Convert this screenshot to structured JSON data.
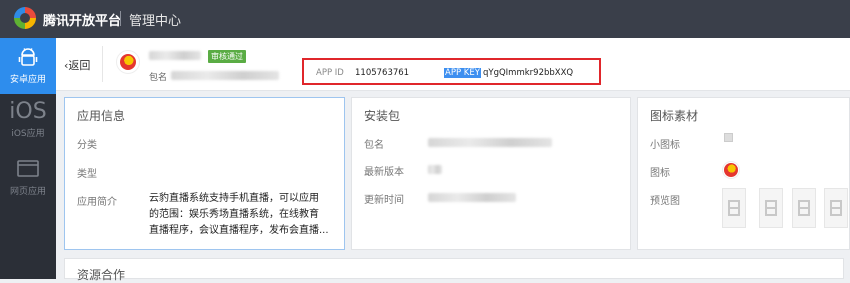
{
  "topbar": {
    "brand": "腾讯开放平台",
    "title": "管理中心",
    "logo_icon": "tencent-open-platform-logo-icon"
  },
  "sidebar": {
    "items": [
      {
        "label": "安卓应用",
        "icon": "android-icon",
        "active": true
      },
      {
        "label": "iOS应用",
        "icon": "ios-icon",
        "icon_text": "iOS",
        "active": false
      },
      {
        "label": "网页应用",
        "icon": "browser-window-icon",
        "active": false
      }
    ]
  },
  "subheader": {
    "back_label": "返回",
    "back_icon": "chevron-left-icon",
    "status_badge": "审核通过",
    "package_label": "包名",
    "app_id_label": "APP ID",
    "app_id_value": "1105763761",
    "app_key_label": "APP KEY",
    "app_key_value": "qYgQImmkr92bbXXQ",
    "highlight_color": "#e0262b"
  },
  "panels": {
    "app_info": {
      "title": "应用信息",
      "category_label": "分类",
      "type_label": "类型",
      "summary_label": "应用简介",
      "summary_lines": [
        "云豹直播系统支持手机直播，可以应用",
        "的范围：娱乐秀场直播系统，在线教育",
        "直播程序，会议直播程序，发布会直播..."
      ]
    },
    "install": {
      "title": "安装包",
      "package_label": "包名",
      "version_label": "最新版本",
      "updated_label": "更新时间"
    },
    "assets": {
      "title": "图标素材",
      "small_icon_label": "小图标",
      "icon_label": "图标",
      "preview_label": "预览图"
    },
    "resources": {
      "title": "资源合作"
    }
  },
  "colors": {
    "topbar": "#3a3f4a",
    "sidebar": "#2b2f37",
    "active_blue": "#2e8ded",
    "badge_green": "#5aac44"
  }
}
